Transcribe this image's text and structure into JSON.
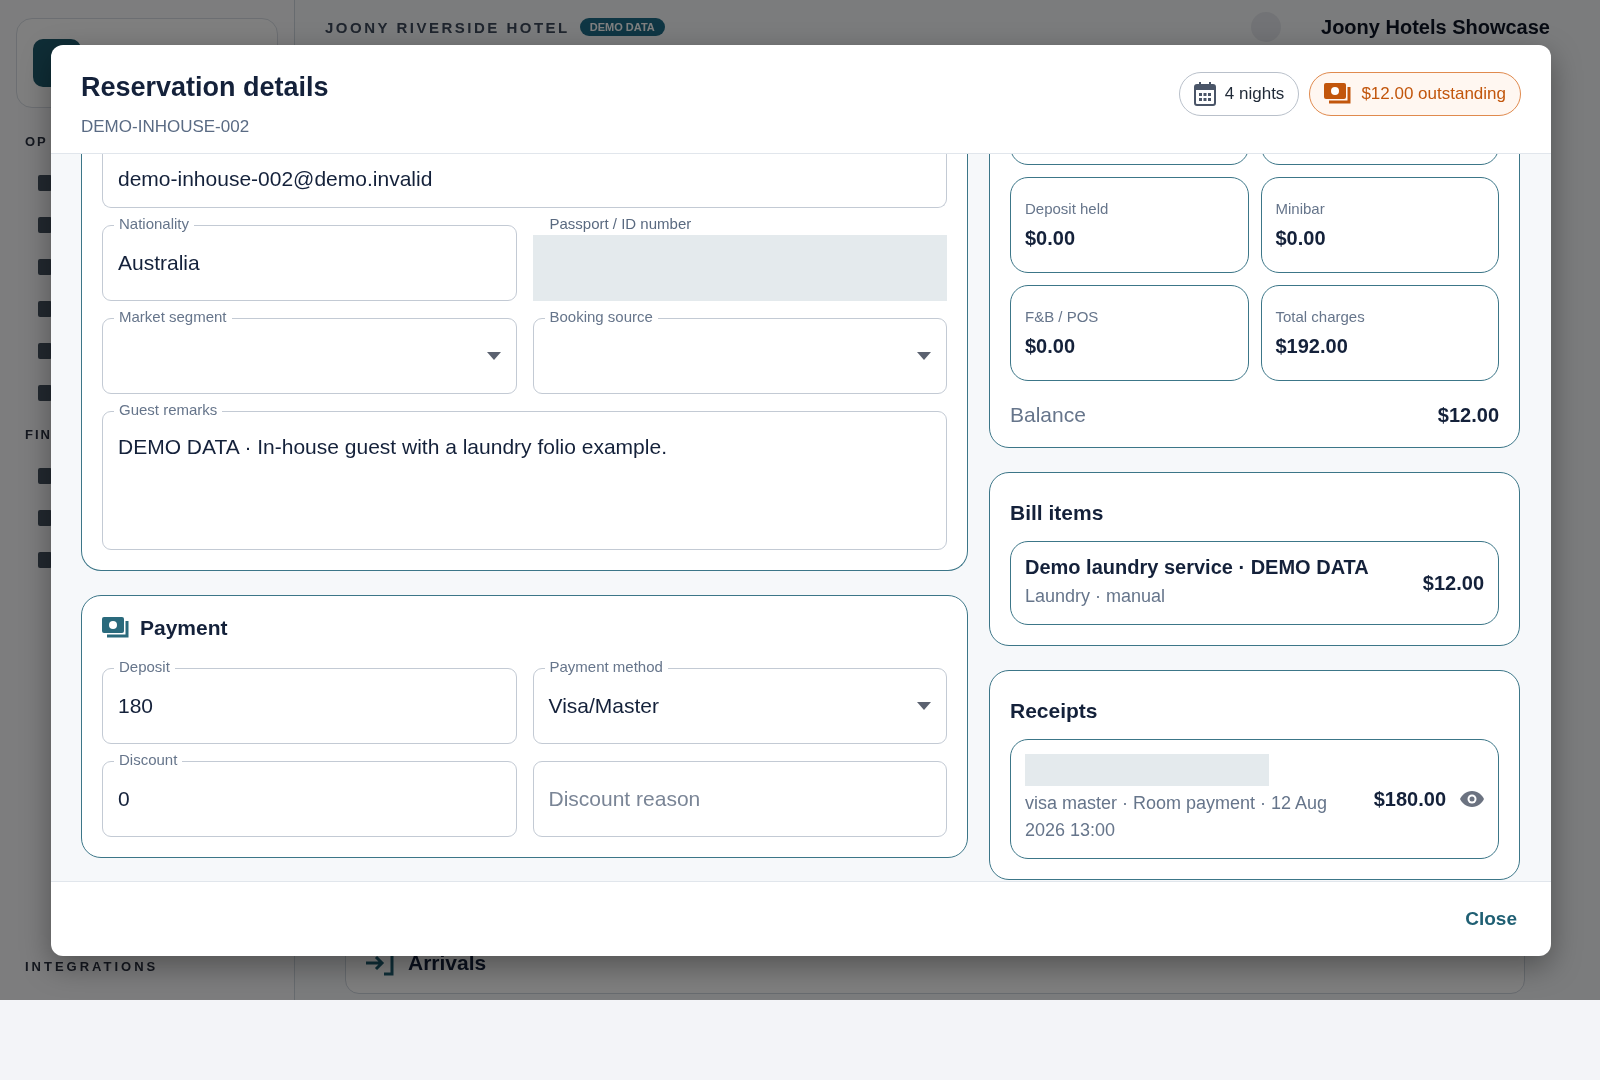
{
  "app": {
    "sidebar_sections": [
      "OP",
      "FIN",
      "INTEGRATIONS"
    ],
    "hotel_name": "JOONY RIVERSIDE HOTEL",
    "badge": "DEMO DATA",
    "account": "Joony Hotels Showcase",
    "arrivals": "Arrivals"
  },
  "dialog": {
    "title": "Reservation details",
    "subtitle": "DEMO-INHOUSE-002",
    "chips": [
      {
        "kind": "nights",
        "label": "4 nights"
      },
      {
        "kind": "outstanding",
        "label": "$12.00 outstanding"
      }
    ],
    "guest_fields": [
      {
        "kind": "text",
        "value": "demo-inhouse-002@demo.invalid",
        "wide": true
      },
      {
        "kind": "text",
        "label": "Nationality",
        "value": "Australia"
      },
      {
        "kind": "redacted",
        "label": "Passport / ID number"
      },
      {
        "kind": "select",
        "label": "Market segment"
      },
      {
        "kind": "select",
        "label": "Booking source"
      },
      {
        "kind": "textarea",
        "label": "Guest remarks",
        "value": "DEMO DATA · In-house guest with a laundry folio example.",
        "wide": true
      }
    ],
    "payment": {
      "title": "Payment",
      "fields": [
        {
          "kind": "text",
          "label": "Deposit",
          "value": "180"
        },
        {
          "kind": "select",
          "label": "Payment method",
          "value": "Visa/Master"
        },
        {
          "kind": "text",
          "label": "Discount",
          "value": "0"
        },
        {
          "kind": "text",
          "placeholder": "Discount reason"
        }
      ]
    },
    "charges": {
      "tiles": [
        {
          "label": "Deposit held",
          "value": "$0.00"
        },
        {
          "label": "Minibar",
          "value": "$0.00"
        },
        {
          "label": "F&B / POS",
          "value": "$0.00"
        },
        {
          "label": "Total charges",
          "value": "$192.00"
        }
      ],
      "balance_label": "Balance",
      "balance": "$12.00"
    },
    "bill_items": {
      "title": "Bill items",
      "items": [
        {
          "title": "Demo laundry service · DEMO DATA",
          "meta": "Laundry · manual",
          "amount": "$12.00"
        }
      ]
    },
    "receipts": {
      "title": "Receipts",
      "items": [
        {
          "meta": "visa master · Room payment · 12 Aug 2026 13:00",
          "amount": "$180.00"
        }
      ]
    },
    "close": "Close"
  }
}
